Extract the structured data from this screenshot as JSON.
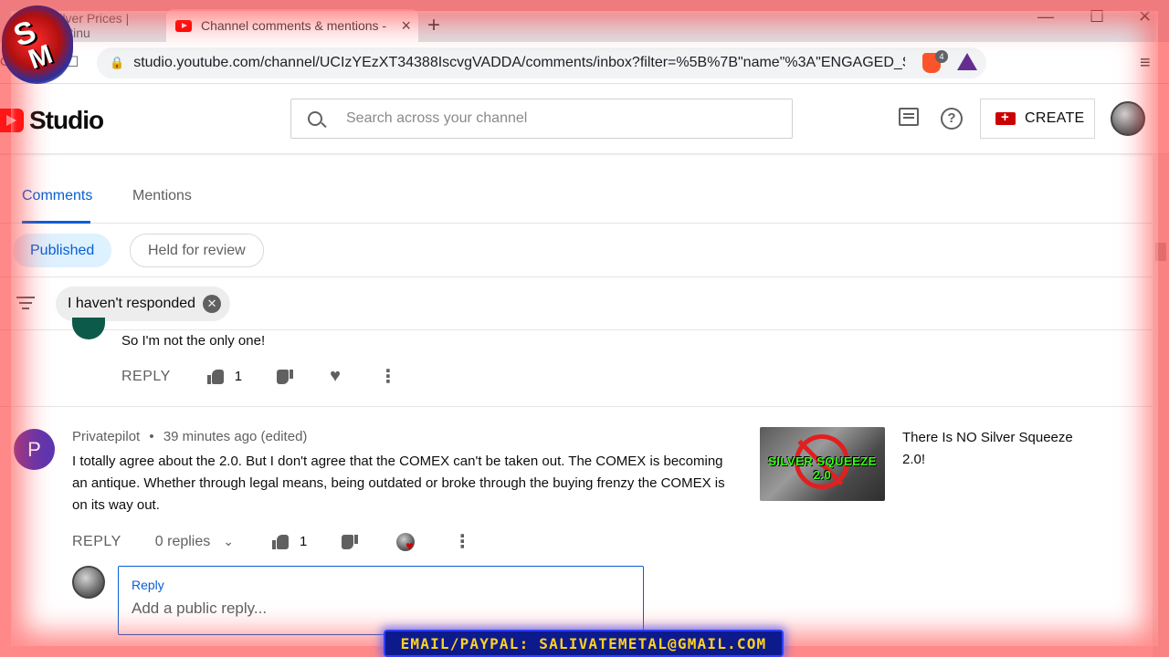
{
  "browser": {
    "tabs": [
      {
        "label": "Silver Prices | Platinu"
      },
      {
        "label": "Channel comments & mentions -"
      }
    ],
    "url": "studio.youtube.com/channel/UCIzYEzXT34388IscvgVADDA/comments/inbox?filter=%5B%7B\"name\"%3A\"ENGAGED_S...",
    "brave_badge": "4",
    "new_tab": "+",
    "tab_close": "×",
    "minimize": "—",
    "maximize": "☐",
    "close": "✕",
    "menu": "≡"
  },
  "studio": {
    "logo_text": "Studio",
    "search_placeholder": "Search across your channel",
    "create_label": "CREATE",
    "help_glyph": "?"
  },
  "tabs": [
    {
      "label": "Comments",
      "active": true
    },
    {
      "label": "Mentions",
      "active": false
    }
  ],
  "chips": {
    "published": "Published",
    "held": "Held for review",
    "filter": "I haven't responded"
  },
  "prev_comment": {
    "text": "So I'm not the only one!",
    "reply": "REPLY",
    "likes": "1"
  },
  "comment": {
    "avatar_letter": "P",
    "author": "Privatepilot",
    "separator": "•",
    "time": "39 minutes ago (edited)",
    "text": "I totally agree about the 2.0. But I don't agree that the COMEX can't be taken out. The COMEX is becoming an antique. Whether through legal means, being outdated or broke through the buying frenzy the COMEX is on its way out.",
    "reply": "REPLY",
    "replies": "0 replies",
    "likes": "1",
    "video_title": "There Is NO Silver Squeeze 2.0!",
    "thumbnail_text": "SILVER SQUEEZE 2.0"
  },
  "reply_box": {
    "label": "Reply",
    "placeholder": "Add a public reply..."
  },
  "overlay": {
    "logo_s": "S",
    "logo_m": "M",
    "email": "EMAIL/PAYPAL: SALIVATEMETAL@GMAIL.COM"
  },
  "colors": {
    "accent": "#065fd4",
    "brand_red": "#ff0000",
    "avatar_purple": "#5e35b1",
    "chip_selected_bg": "#def1ff",
    "frame": "#ff2828",
    "banner_text": "#ffd21f"
  },
  "icons": [
    "search-icon",
    "feedback-icon",
    "help-icon",
    "create-camera-icon",
    "filter-icon",
    "clear-filter-icon",
    "like-icon",
    "dislike-icon",
    "heart-icon",
    "more-icon",
    "chevron-down-icon",
    "lock-icon"
  ]
}
